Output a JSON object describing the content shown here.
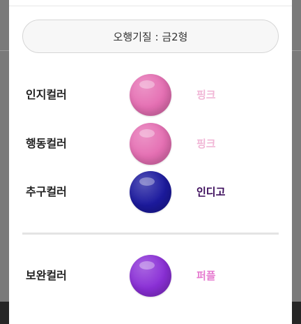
{
  "type_label": "오행기질 : 금2형",
  "rows": [
    {
      "label": "인지컬러",
      "color_name": "핑크",
      "swatch": "#e56fb3",
      "text_color": "#f1b6d6"
    },
    {
      "label": "행동컬러",
      "color_name": "핑크",
      "swatch": "#e56fb3",
      "text_color": "#f1b6d6"
    },
    {
      "label": "추구컬러",
      "color_name": "인디고",
      "swatch": "#1c1a9e",
      "text_color": "#3a0a5a"
    },
    {
      "label": "보완컬러",
      "color_name": "퍼플",
      "swatch": "#8a2fd6",
      "text_color": "#e67bd0"
    }
  ]
}
